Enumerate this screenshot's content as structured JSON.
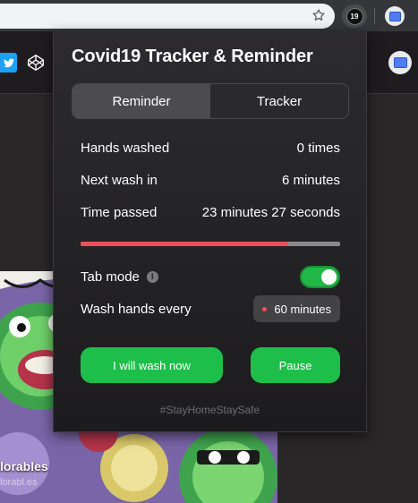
{
  "browser": {
    "extension_badge": "19"
  },
  "page": {
    "card_title": "lorables",
    "card_subtitle": "lorabl.es"
  },
  "popup": {
    "title": "Covid19 Tracker & Reminder",
    "tabs": [
      {
        "label": "Reminder",
        "active": true
      },
      {
        "label": "Tracker",
        "active": false
      }
    ],
    "stats": {
      "hands_washed_label": "Hands washed",
      "hands_washed_value": "0 times",
      "next_wash_label": "Next wash in",
      "next_wash_value": "6 minutes",
      "time_passed_label": "Time passed",
      "time_passed_value": "23 minutes 27 seconds"
    },
    "progress_fraction": 0.8,
    "tab_mode": {
      "label": "Tab mode",
      "info_glyph": "i",
      "enabled": true
    },
    "wash_interval": {
      "label": "Wash hands every",
      "value": "60 minutes"
    },
    "buttons": {
      "wash_label": "I will wash now",
      "pause_label": "Pause"
    },
    "hashtag": "#StayHomeStaySafe"
  },
  "colors": {
    "accent_green": "#1dbf4a",
    "progress_red": "#ef4f5b",
    "popup_bg": "#2c2b2d"
  },
  "icons": [
    "star-icon",
    "extension-icon",
    "profile-icon",
    "twitter-icon",
    "codepen-icon",
    "info-icon"
  ]
}
